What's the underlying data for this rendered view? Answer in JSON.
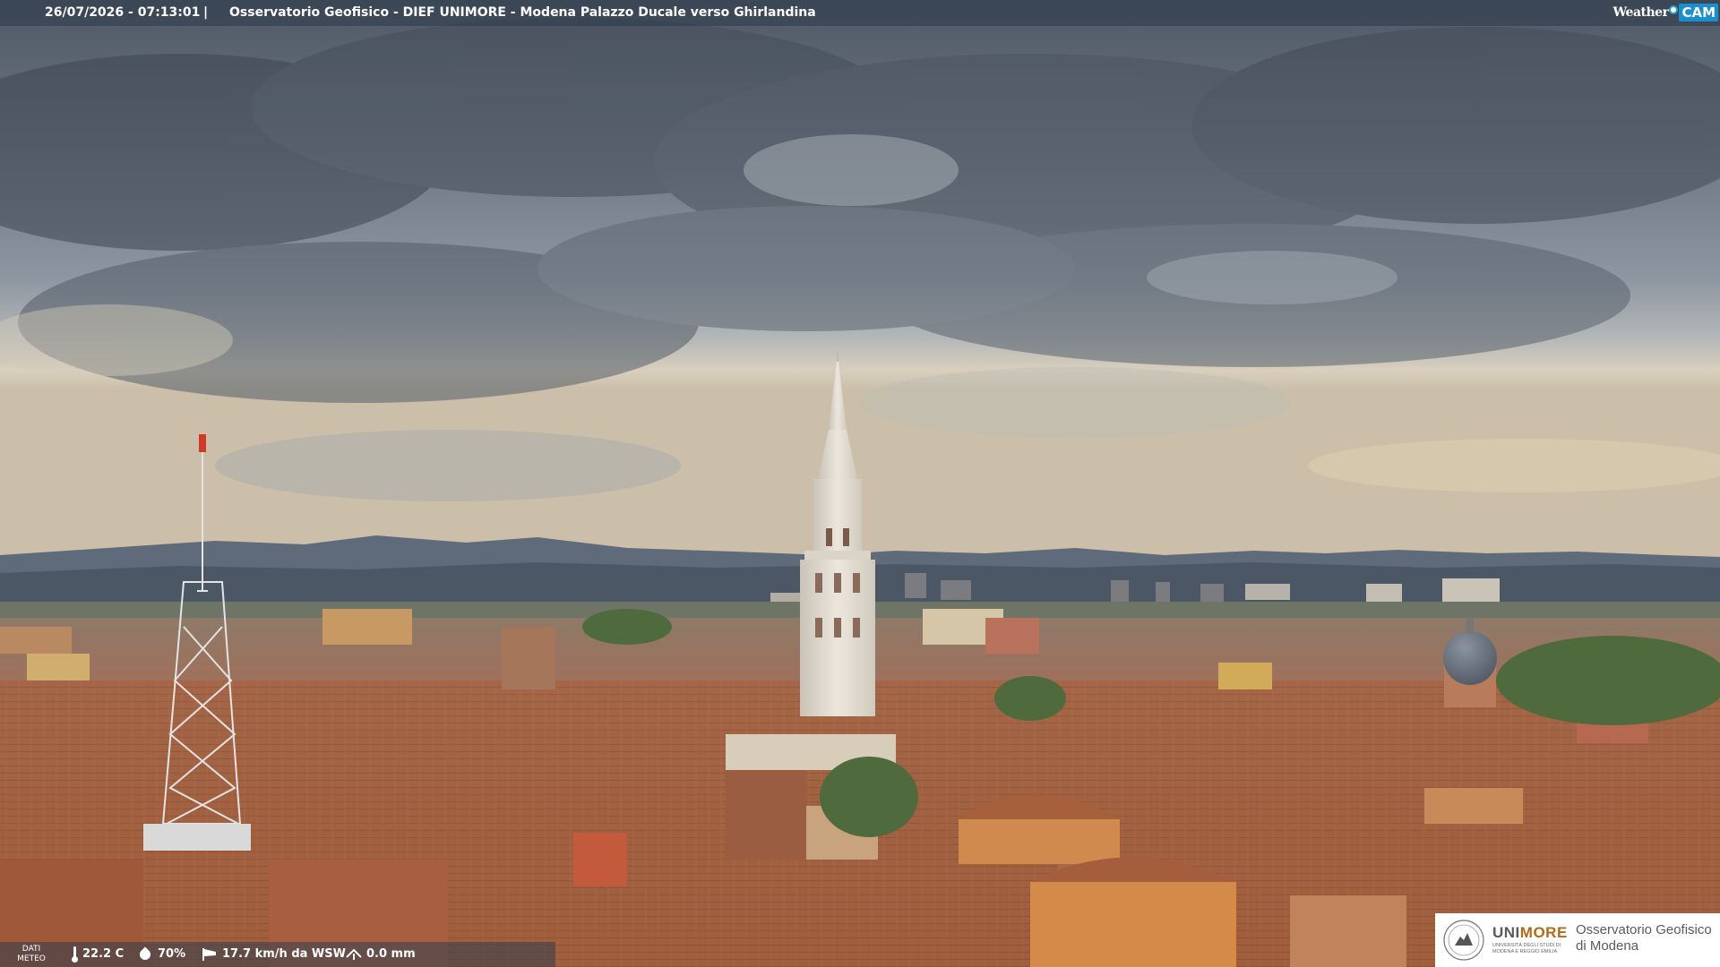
{
  "header": {
    "timestamp": "26/07/2026 - 07:13:01",
    "separator": "|",
    "title": "Osservatorio Geofisico - DIEF UNIMORE - Modena Palazzo Ducale verso Ghirlandina",
    "brand_weather": "Weather",
    "brand_cam": "CAM"
  },
  "weather": {
    "label_line1": "DATI",
    "label_line2": "METEO",
    "temperature": "22.2 C",
    "humidity": "70%",
    "wind": "17.7 km/h da WSW",
    "rain": "0.0 mm",
    "icons": [
      "thermometer-icon",
      "humidity-drop-icon",
      "wind-sock-icon",
      "rain-gauge-icon"
    ]
  },
  "logo": {
    "uni_prefix": "UNI",
    "uni_suffix": "MORE",
    "uni_sub_line1": "UNIVERSITÀ DEGLI STUDI DI",
    "uni_sub_line2": "MODENA E REGGIO EMILIA",
    "observatory_line1": "Osservatorio Geofisico",
    "observatory_line2": "di Modena"
  },
  "colors": {
    "overlay_bar": "#2c3848",
    "brand_blue": "#1a8fd0",
    "unimore_orange": "#b46a16",
    "roof_terracotta": "#a8623a",
    "tower_marble": "#e2ddd3"
  }
}
